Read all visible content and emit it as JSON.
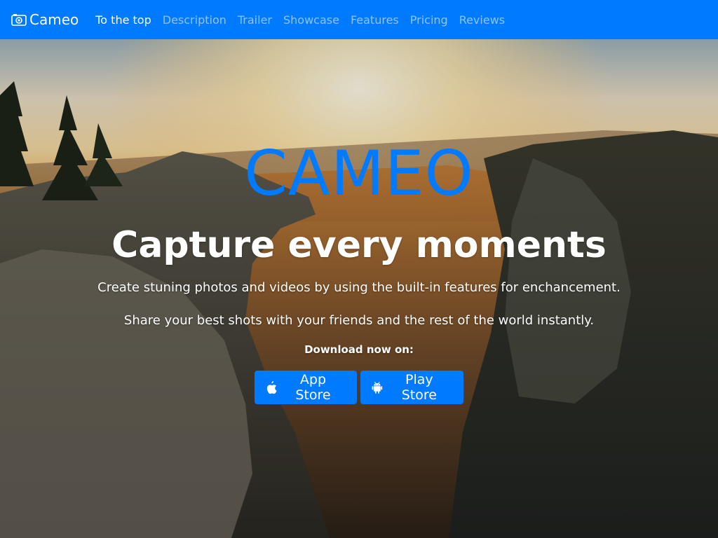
{
  "navbar": {
    "brand": {
      "icon": "camera-icon",
      "label": "Cameo"
    },
    "links": [
      {
        "label": "To the top",
        "active": true
      },
      {
        "label": "Description",
        "active": false
      },
      {
        "label": "Trailer",
        "active": false
      },
      {
        "label": "Showcase",
        "active": false
      },
      {
        "label": "Features",
        "active": false
      },
      {
        "label": "Pricing",
        "active": false
      },
      {
        "label": "Reviews",
        "active": false
      }
    ]
  },
  "hero": {
    "logo_text": "CAMEO",
    "title": "Capture every moments",
    "line1": "Create stuning photos and videos by using the built-in features for enchancement.",
    "line2": "Share your best shots with your friends and the rest of the world instantly.",
    "download_label": "Download now on:",
    "buttons": {
      "app_store": {
        "icon": "apple-icon",
        "label": "App Store"
      },
      "play_store": {
        "icon": "android-icon",
        "label": "Play Store"
      }
    }
  },
  "colors": {
    "primary": "#007bff",
    "nav_inactive": "rgba(255,255,255,0.55)",
    "text": "#ffffff"
  }
}
